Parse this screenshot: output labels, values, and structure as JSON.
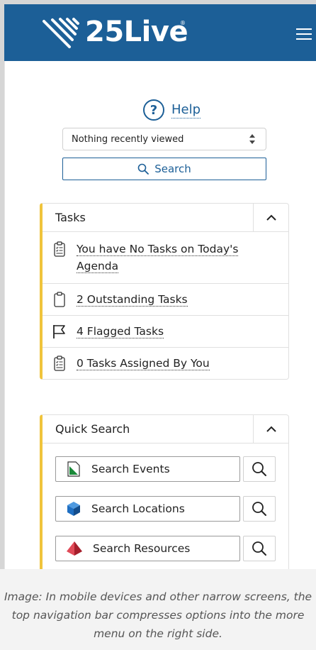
{
  "header": {
    "brand": "25Live",
    "reg_mark": "®"
  },
  "help": {
    "icon": "question-circle-icon",
    "label": "Help"
  },
  "recent": {
    "selected": "Nothing recently viewed"
  },
  "search": {
    "label": "Search"
  },
  "tasks": {
    "title": "Tasks",
    "items": [
      {
        "icon": "checklist-clipboard-icon",
        "label": "You have No Tasks on Today's Agenda"
      },
      {
        "icon": "clipboard-icon",
        "label": "2 Outstanding Tasks"
      },
      {
        "icon": "flag-icon",
        "label": "4 Flagged Tasks"
      },
      {
        "icon": "checklist-clipboard-icon",
        "label": "0 Tasks Assigned By You"
      }
    ]
  },
  "quick_search": {
    "title": "Quick Search",
    "items": [
      {
        "icon": "events-icon",
        "label": "Search Events",
        "color": "#1b8a3a"
      },
      {
        "icon": "locations-cube-icon",
        "label": "Search Locations",
        "color": "#1f6fc2"
      },
      {
        "icon": "resources-pyramid-icon",
        "label": "Search Resources",
        "color": "#c02a3a"
      }
    ]
  },
  "caption": "Image: In mobile devices and other narrow screens, the top navigation bar compresses options into the more menu on the right side."
}
